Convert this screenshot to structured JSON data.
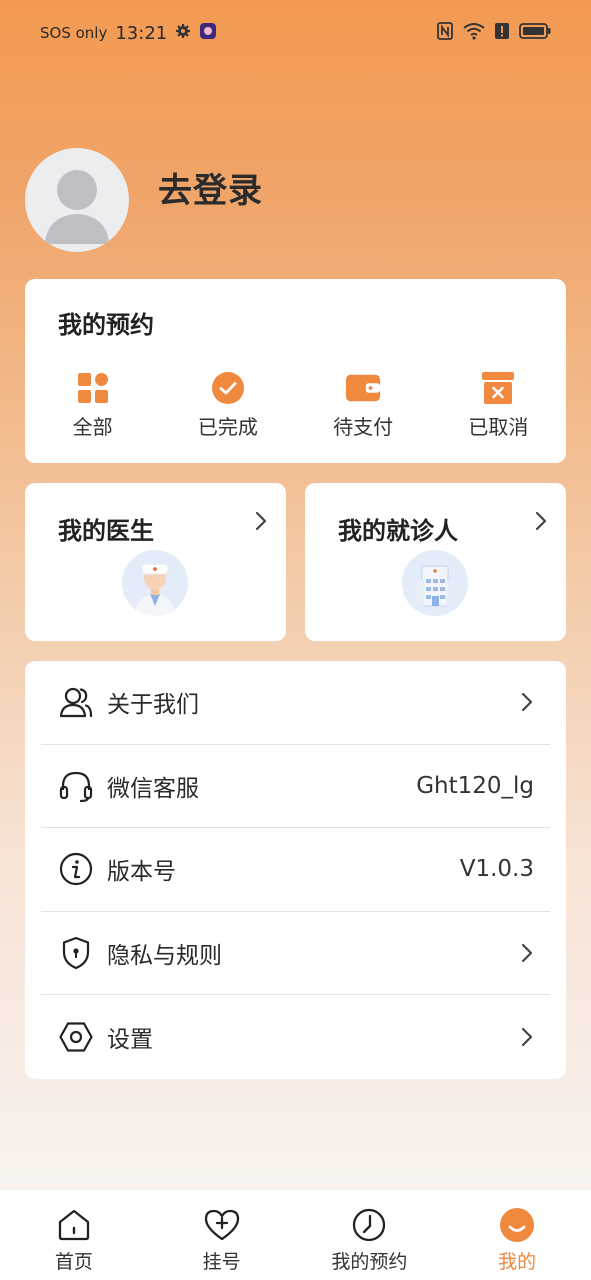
{
  "status_bar": {
    "carrier": "SOS only",
    "time": "13:21"
  },
  "profile": {
    "login_label": "去登录"
  },
  "appointments": {
    "title": "我的预约",
    "items": [
      {
        "label": "全部",
        "icon": "grid-icon"
      },
      {
        "label": "已完成",
        "icon": "check-circle-icon"
      },
      {
        "label": "待支付",
        "icon": "wallet-icon"
      },
      {
        "label": "已取消",
        "icon": "cancel-box-icon"
      }
    ]
  },
  "doctor_card": {
    "title": "我的医生"
  },
  "patient_card": {
    "title": "我的就诊人"
  },
  "menu": [
    {
      "label": "关于我们",
      "value": "",
      "icon": "users-icon"
    },
    {
      "label": "微信客服",
      "value": "Ght120_lg",
      "icon": "headset-icon"
    },
    {
      "label": "版本号",
      "value": "V1.0.3",
      "icon": "info-icon"
    },
    {
      "label": "隐私与规则",
      "value": "",
      "icon": "shield-icon"
    },
    {
      "label": "设置",
      "value": "",
      "icon": "settings-hex-icon"
    }
  ],
  "tabs": [
    {
      "label": "首页",
      "icon": "home-icon"
    },
    {
      "label": "挂号",
      "icon": "heart-plus-icon"
    },
    {
      "label": "我的预约",
      "icon": "clock-icon"
    },
    {
      "label": "我的",
      "icon": "smile-icon",
      "active": true
    }
  ],
  "colors": {
    "accent": "#F0883E",
    "header_top": "#F39A52"
  }
}
